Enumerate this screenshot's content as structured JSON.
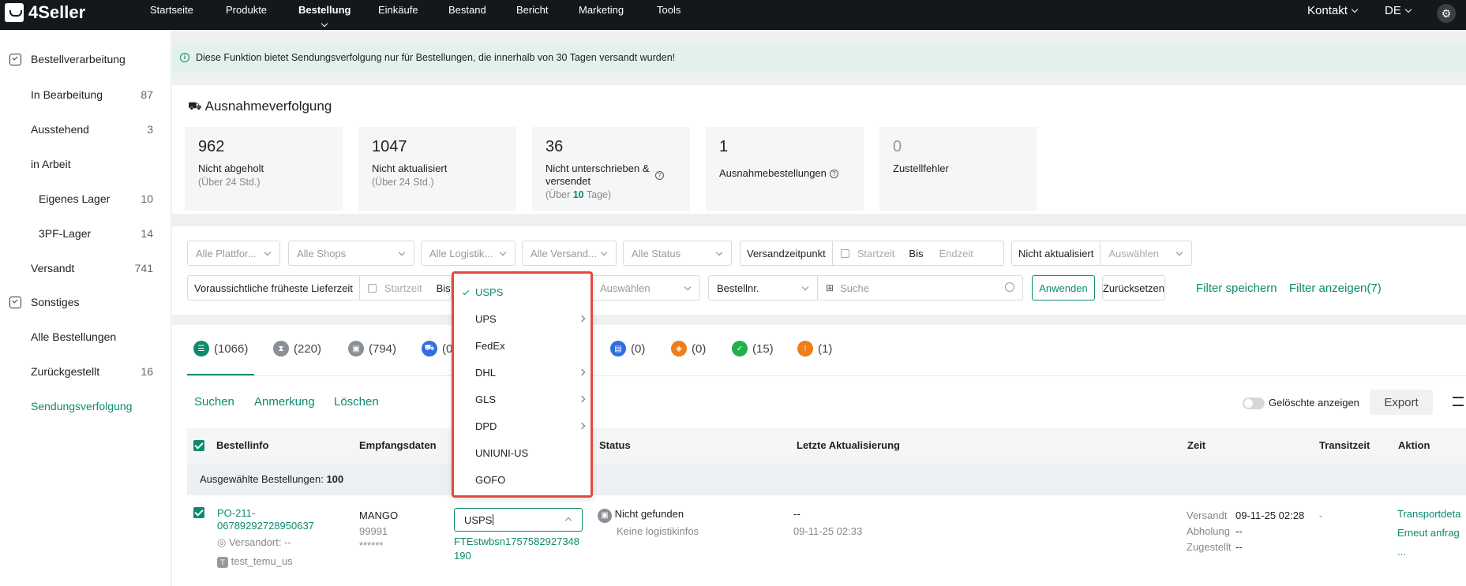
{
  "brand": {
    "name": "4Seller"
  },
  "nav": {
    "items": [
      "Startseite",
      "Produkte",
      "Bestellung",
      "Einkäufe",
      "Bestand",
      "Bericht",
      "Marketing",
      "Tools"
    ],
    "active": "Bestellung"
  },
  "top_right": {
    "contact": "Kontakt",
    "lang": "DE"
  },
  "sidebar": {
    "section1": "Bestellverarbeitung",
    "items1": [
      {
        "label": "In Bearbeitung",
        "count": "87"
      },
      {
        "label": "Ausstehend",
        "count": "3"
      },
      {
        "label": "in Arbeit",
        "count": ""
      },
      {
        "label": "Eigenes Lager",
        "count": "10"
      },
      {
        "label": "3PF-Lager",
        "count": "14"
      },
      {
        "label": "Versandt",
        "count": "741"
      }
    ],
    "section2": "Sonstiges",
    "items2": [
      {
        "label": "Alle Bestellungen",
        "count": ""
      },
      {
        "label": "Zurückgestellt",
        "count": "16"
      },
      {
        "label": "Sendungsverfolgung",
        "count": ""
      }
    ]
  },
  "notice": "Diese Funktion bietet Sendungsverfolgung nur für Bestellungen, die innerhalb von 30 Tagen versandt wurden!",
  "exceptions": {
    "title": "Ausnahmeverfolgung",
    "stats": [
      {
        "num": "962",
        "label": "Nicht abgeholt",
        "sub": "(Über 24 Std.)"
      },
      {
        "num": "1047",
        "label": "Nicht aktualisiert",
        "sub": "(Über 24 Std.)"
      },
      {
        "num": "36",
        "label": "Nicht unterschrieben & versendet",
        "sub_pre": "(Über ",
        "sub_num": "10",
        "sub_post": " Tage)"
      },
      {
        "num": "1",
        "label": "Ausnahmebestellungen"
      },
      {
        "num": "0",
        "label": "Zustellfehler"
      }
    ]
  },
  "filters": {
    "platform": "Alle Plattfor...",
    "shops": "Alle Shops",
    "logistics": "Alle Logistik...",
    "shipping": "Alle Versand...",
    "status": "Alle Status",
    "ship_time_label": "Versandzeitpunkt",
    "start": "Startzeit",
    "bis": "Bis",
    "end": "Endzeit",
    "not_updated_label": "Nicht aktualisiert",
    "select": "Auswählen",
    "earliest_label": "Voraussichtliche früheste Lieferzeit",
    "start2": "Startzeit",
    "bis2": "Bis",
    "select2": "Auswählen",
    "order_no": "Bestellnr.",
    "search_ph": "Suche",
    "apply": "Anwenden",
    "reset": "Zurücksetzen",
    "save": "Filter speichern",
    "show": "Filter anzeigen(7)"
  },
  "tabs": [
    {
      "count": "(1066)",
      "color": "#0d8a6e"
    },
    {
      "count": "(220)",
      "color": "#8a9096"
    },
    {
      "count": "(794)",
      "color": "#8a9096"
    },
    {
      "count": "(0",
      "color": "#2f6fe0"
    },
    {
      "count": "(0)",
      "color": "#2f6fe0"
    },
    {
      "count": "(0)",
      "color": "#f07d1a"
    },
    {
      "count": "(15)",
      "color": "#22b04b"
    },
    {
      "count": "(1)",
      "color": "#f07d1a"
    }
  ],
  "actions": {
    "search": "Suchen",
    "note": "Anmerkung",
    "delete": "Löschen",
    "show_deleted": "Gelöschte anzeigen",
    "export": "Export"
  },
  "table": {
    "headers": [
      "Bestellinfo",
      "Empfangsdaten",
      "Status",
      "Letzte Aktualisierung",
      "Zeit",
      "Transitzeit",
      "Aktion"
    ],
    "selected_label": "Ausgewählte Bestellungen: ",
    "selected_count": "100",
    "row": {
      "order_id": "PO-211-06789292728950637",
      "ship_from": "Versandort: --",
      "shop": "test_temu_us",
      "recipient": "MANGO",
      "zip": "99991",
      "masked": "******",
      "tracking": "FTEstwbsn1757582927348190",
      "status": "Nicht gefunden",
      "status_sub": "Keine logistikinfos",
      "last_update": "--",
      "last_update_time": "09-11-25 02:33",
      "time_labels": [
        "Versandt",
        "Abholung",
        "Zugestellt"
      ],
      "time_values": [
        "09-11-25 02:28",
        "--",
        "--"
      ],
      "transit": "-",
      "action1": "Transportdeta",
      "action2": "Erneut anfrag",
      "action3": "..."
    }
  },
  "carrier_dropdown": {
    "options": [
      {
        "label": "USPS",
        "selected": true,
        "sub": false
      },
      {
        "label": "UPS",
        "selected": false,
        "sub": true
      },
      {
        "label": "FedEx",
        "selected": false,
        "sub": false
      },
      {
        "label": "DHL",
        "selected": false,
        "sub": true
      },
      {
        "label": "GLS",
        "selected": false,
        "sub": true
      },
      {
        "label": "DPD",
        "selected": false,
        "sub": true
      },
      {
        "label": "UNIUNI-US",
        "selected": false,
        "sub": false
      },
      {
        "label": "GOFO",
        "selected": false,
        "sub": false
      }
    ],
    "input_value": "USPS"
  }
}
